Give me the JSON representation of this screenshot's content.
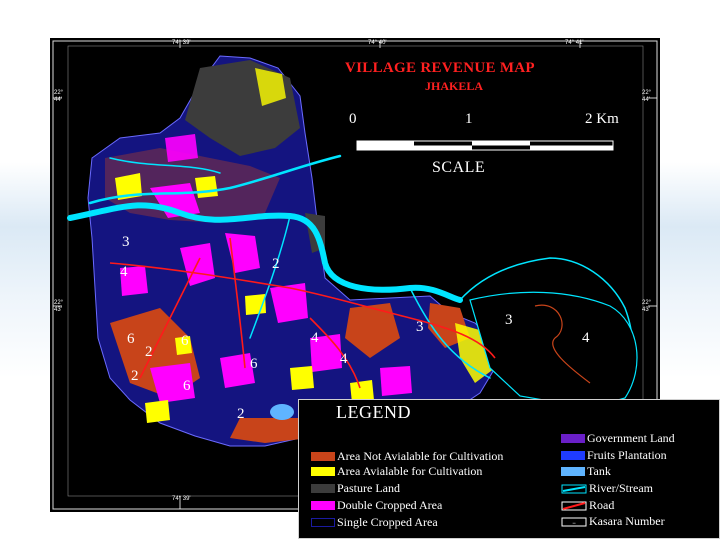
{
  "map": {
    "title": "VILLAGE REVENUE MAP",
    "subtitle": "JHAKELA",
    "coordinates": {
      "top": [
        "74° 39'",
        "74° 40'",
        "74° 41'"
      ],
      "bottom": [
        "74° 39'"
      ],
      "left": [
        "22°\n44'",
        "22°\n43'"
      ],
      "right": [
        "22°\n44'",
        "22°\n43'"
      ]
    },
    "scale": {
      "labels": [
        "0",
        "1",
        "2 Km"
      ],
      "caption": "SCALE"
    },
    "kasara_numbers": [
      "3",
      "4",
      "2",
      "3",
      "4",
      "6",
      "4",
      "4",
      "2",
      "6",
      "6",
      "2",
      "6",
      "2",
      "3"
    ],
    "colors": {
      "not_available": "#c8441a",
      "available": "#ffff00",
      "pasture": "#3c3c3c",
      "double_cropped": "#ff00ff",
      "single_cropped": "#1a1aa0",
      "government": "#6a1fc8",
      "fruits": "#1f3cff",
      "tank": "#5fb4ff",
      "river": "#00e5ff",
      "road": "#ff1a1a"
    }
  },
  "legend": {
    "title": "LEGEND",
    "left_items": [
      {
        "label": "Area Not Avialable for Cultivation",
        "color": "#c8441a"
      },
      {
        "label": "Area Avialable for Cultivation",
        "color": "#ffff00"
      },
      {
        "label": "Pasture Land",
        "color": "#3c3c3c"
      },
      {
        "label": "Double Cropped Area",
        "color": "#ff00ff"
      },
      {
        "label": "Single Cropped Area",
        "color": "#1a1aa0"
      }
    ],
    "right_items": [
      {
        "label": "Government Land",
        "color": "#6a1fc8"
      },
      {
        "label": "Fruits Plantation",
        "color": "#1f3cff"
      },
      {
        "label": "Tank",
        "color": "#5fb4ff"
      },
      {
        "label": "River/Stream",
        "color": "#00e5ff"
      },
      {
        "label": "Road",
        "color": "#ff1a1a"
      },
      {
        "label": "Kasara Number",
        "color": "#ffffff"
      }
    ]
  }
}
